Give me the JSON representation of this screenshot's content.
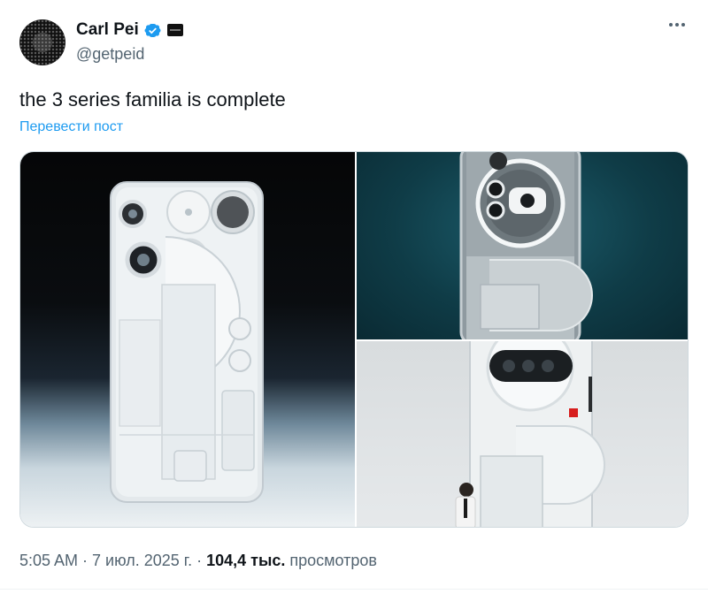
{
  "author": {
    "display_name": "Carl Pei",
    "handle": "@getpeid",
    "verified": true,
    "avatar_icon": "avatar-image",
    "affiliation_icon": "affiliation-badge-icon"
  },
  "tweet": {
    "text": "the 3 series familia is complete",
    "translate_label": "Перевести пост"
  },
  "media": {
    "images": [
      {
        "name": "phone-back-white"
      },
      {
        "name": "phone-closeup-teal"
      },
      {
        "name": "phone-giant-with-person"
      }
    ]
  },
  "footer": {
    "time": "5:05 AM",
    "date": "7 июл. 2025 г.",
    "sep": "·",
    "views_count": "104,4 тыс.",
    "views_label": "просмотров"
  },
  "colors": {
    "accent": "#1d9bf0",
    "text": "#0f1419",
    "muted": "#536471"
  }
}
